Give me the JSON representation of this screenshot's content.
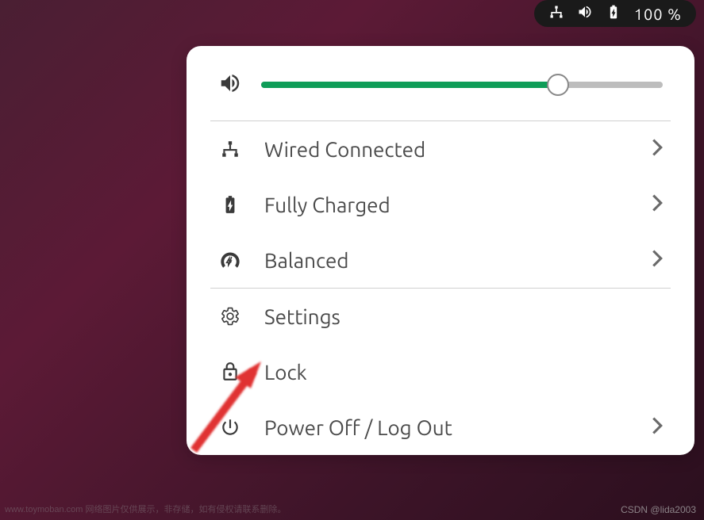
{
  "top_bar": {
    "battery_text": "100 %"
  },
  "popup": {
    "volume": {
      "percent": 74
    },
    "menu": {
      "network": {
        "label": "Wired Connected"
      },
      "battery": {
        "label": "Fully Charged"
      },
      "power_mode": {
        "label": "Balanced"
      },
      "settings": {
        "label": "Settings"
      },
      "lock": {
        "label": "Lock"
      },
      "power": {
        "label": "Power Off / Log Out"
      }
    }
  },
  "watermarks": {
    "left": "www.toymoban.com 网络图片仅供展示，非存储，如有侵权请联系删除。",
    "right": "CSDN @lida2003"
  }
}
